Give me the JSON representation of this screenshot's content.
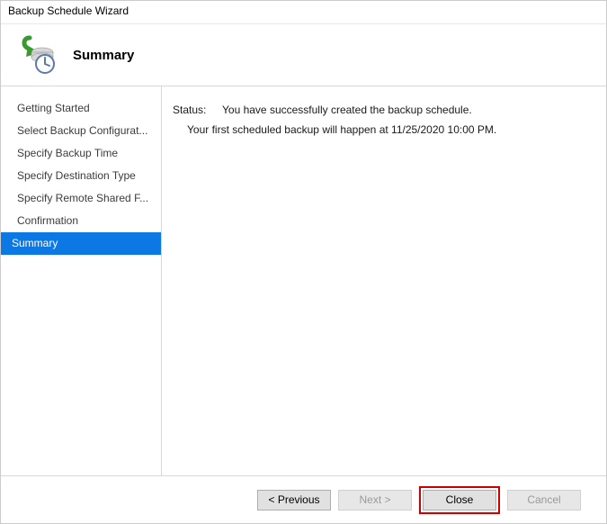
{
  "window": {
    "title": "Backup Schedule Wizard"
  },
  "header": {
    "title": "Summary"
  },
  "sidebar": {
    "items": [
      {
        "label": "Getting Started"
      },
      {
        "label": "Select Backup Configurat..."
      },
      {
        "label": "Specify Backup Time"
      },
      {
        "label": "Specify Destination Type"
      },
      {
        "label": "Specify Remote Shared F..."
      },
      {
        "label": "Confirmation"
      },
      {
        "label": "Summary"
      }
    ]
  },
  "content": {
    "status_label": "Status:",
    "status_message": "You have successfully created the backup schedule.",
    "status_detail": "Your first scheduled backup will happen at 11/25/2020 10:00 PM."
  },
  "footer": {
    "previous": "< Previous",
    "next": "Next >",
    "close": "Close",
    "cancel": "Cancel"
  }
}
